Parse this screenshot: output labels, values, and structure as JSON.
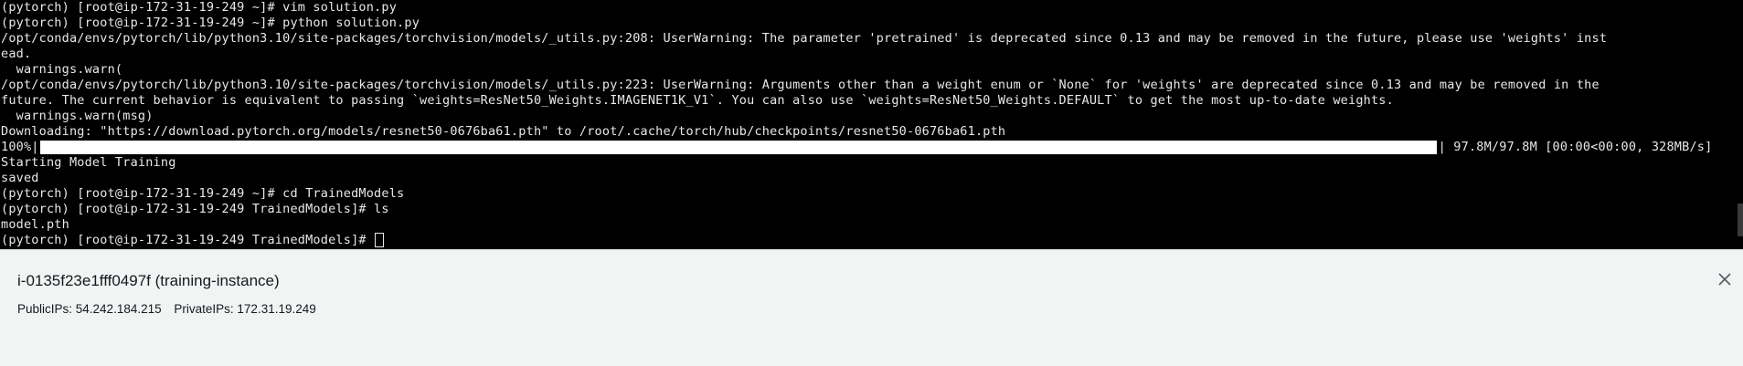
{
  "terminal": {
    "lines": [
      "(pytorch) [root@ip-172-31-19-249 ~]# vim solution.py",
      "(pytorch) [root@ip-172-31-19-249 ~]# python solution.py",
      "/opt/conda/envs/pytorch/lib/python3.10/site-packages/torchvision/models/_utils.py:208: UserWarning: The parameter 'pretrained' is deprecated since 0.13 and may be removed in the future, please use 'weights' inst",
      "ead.",
      "  warnings.warn(",
      "/opt/conda/envs/pytorch/lib/python3.10/site-packages/torchvision/models/_utils.py:223: UserWarning: Arguments other than a weight enum or `None` for 'weights' are deprecated since 0.13 and may be removed in the",
      "future. The current behavior is equivalent to passing `weights=ResNet50_Weights.IMAGENET1K_V1`. You can also use `weights=ResNet50_Weights.DEFAULT` to get the most up-to-date weights.",
      "  warnings.warn(msg)",
      "Downloading: \"https://download.pytorch.org/models/resnet50-0676ba61.pth\" to /root/.cache/torch/hub/checkpoints/resnet50-0676ba61.pth"
    ],
    "progress": {
      "percent_label": "100%|",
      "fraction": 1.0,
      "tail": "| 97.8M/97.8M [00:00<00:00, 328MB/s]"
    },
    "lines_after": [
      "Starting Model Training",
      "saved",
      "(pytorch) [root@ip-172-31-19-249 ~]# cd TrainedModels",
      "(pytorch) [root@ip-172-31-19-249 TrainedModels]# ls",
      "model.pth"
    ],
    "prompt": "(pytorch) [root@ip-172-31-19-249 TrainedModels]# "
  },
  "instance": {
    "title": "i-0135f23e1fff0497f (training-instance)",
    "public_ips": "PublicIPs: 54.242.184.215",
    "private_ips": "PrivateIPs: 172.31.19.249"
  },
  "icons": {
    "close": "close-icon"
  },
  "colors": {
    "terminal_bg": "#000000",
    "terminal_fg": "#e8e8e8",
    "panel_bg": "#f2f3f3"
  }
}
